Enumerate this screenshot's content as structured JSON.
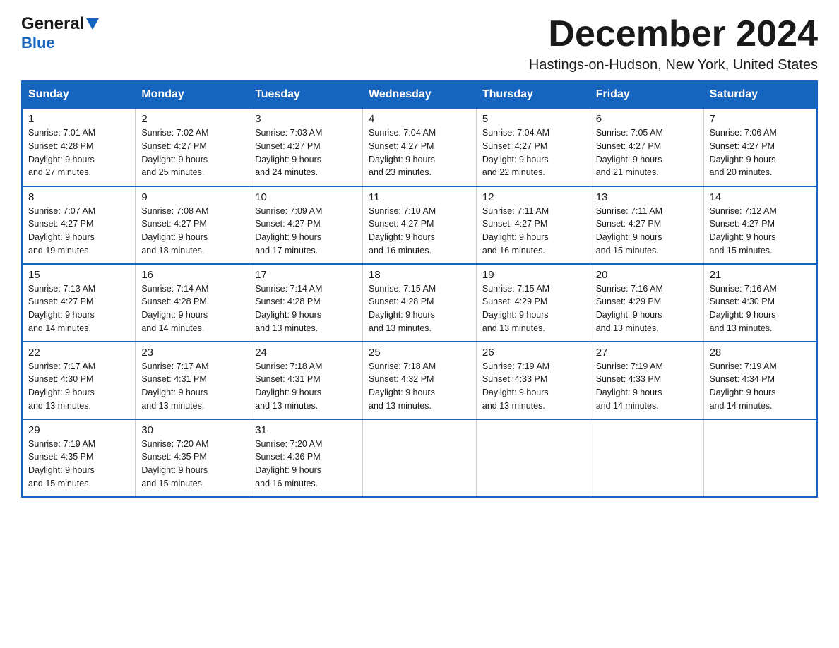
{
  "logo": {
    "general": "General",
    "triangle_alt": "triangle",
    "blue": "Blue"
  },
  "title": {
    "month_year": "December 2024",
    "location": "Hastings-on-Hudson, New York, United States"
  },
  "weekdays": [
    "Sunday",
    "Monday",
    "Tuesday",
    "Wednesday",
    "Thursday",
    "Friday",
    "Saturday"
  ],
  "weeks": [
    [
      {
        "day": "1",
        "sunrise": "7:01 AM",
        "sunset": "4:28 PM",
        "daylight": "9 hours and 27 minutes."
      },
      {
        "day": "2",
        "sunrise": "7:02 AM",
        "sunset": "4:27 PM",
        "daylight": "9 hours and 25 minutes."
      },
      {
        "day": "3",
        "sunrise": "7:03 AM",
        "sunset": "4:27 PM",
        "daylight": "9 hours and 24 minutes."
      },
      {
        "day": "4",
        "sunrise": "7:04 AM",
        "sunset": "4:27 PM",
        "daylight": "9 hours and 23 minutes."
      },
      {
        "day": "5",
        "sunrise": "7:04 AM",
        "sunset": "4:27 PM",
        "daylight": "9 hours and 22 minutes."
      },
      {
        "day": "6",
        "sunrise": "7:05 AM",
        "sunset": "4:27 PM",
        "daylight": "9 hours and 21 minutes."
      },
      {
        "day": "7",
        "sunrise": "7:06 AM",
        "sunset": "4:27 PM",
        "daylight": "9 hours and 20 minutes."
      }
    ],
    [
      {
        "day": "8",
        "sunrise": "7:07 AM",
        "sunset": "4:27 PM",
        "daylight": "9 hours and 19 minutes."
      },
      {
        "day": "9",
        "sunrise": "7:08 AM",
        "sunset": "4:27 PM",
        "daylight": "9 hours and 18 minutes."
      },
      {
        "day": "10",
        "sunrise": "7:09 AM",
        "sunset": "4:27 PM",
        "daylight": "9 hours and 17 minutes."
      },
      {
        "day": "11",
        "sunrise": "7:10 AM",
        "sunset": "4:27 PM",
        "daylight": "9 hours and 16 minutes."
      },
      {
        "day": "12",
        "sunrise": "7:11 AM",
        "sunset": "4:27 PM",
        "daylight": "9 hours and 16 minutes."
      },
      {
        "day": "13",
        "sunrise": "7:11 AM",
        "sunset": "4:27 PM",
        "daylight": "9 hours and 15 minutes."
      },
      {
        "day": "14",
        "sunrise": "7:12 AM",
        "sunset": "4:27 PM",
        "daylight": "9 hours and 15 minutes."
      }
    ],
    [
      {
        "day": "15",
        "sunrise": "7:13 AM",
        "sunset": "4:27 PM",
        "daylight": "9 hours and 14 minutes."
      },
      {
        "day": "16",
        "sunrise": "7:14 AM",
        "sunset": "4:28 PM",
        "daylight": "9 hours and 14 minutes."
      },
      {
        "day": "17",
        "sunrise": "7:14 AM",
        "sunset": "4:28 PM",
        "daylight": "9 hours and 13 minutes."
      },
      {
        "day": "18",
        "sunrise": "7:15 AM",
        "sunset": "4:28 PM",
        "daylight": "9 hours and 13 minutes."
      },
      {
        "day": "19",
        "sunrise": "7:15 AM",
        "sunset": "4:29 PM",
        "daylight": "9 hours and 13 minutes."
      },
      {
        "day": "20",
        "sunrise": "7:16 AM",
        "sunset": "4:29 PM",
        "daylight": "9 hours and 13 minutes."
      },
      {
        "day": "21",
        "sunrise": "7:16 AM",
        "sunset": "4:30 PM",
        "daylight": "9 hours and 13 minutes."
      }
    ],
    [
      {
        "day": "22",
        "sunrise": "7:17 AM",
        "sunset": "4:30 PM",
        "daylight": "9 hours and 13 minutes."
      },
      {
        "day": "23",
        "sunrise": "7:17 AM",
        "sunset": "4:31 PM",
        "daylight": "9 hours and 13 minutes."
      },
      {
        "day": "24",
        "sunrise": "7:18 AM",
        "sunset": "4:31 PM",
        "daylight": "9 hours and 13 minutes."
      },
      {
        "day": "25",
        "sunrise": "7:18 AM",
        "sunset": "4:32 PM",
        "daylight": "9 hours and 13 minutes."
      },
      {
        "day": "26",
        "sunrise": "7:19 AM",
        "sunset": "4:33 PM",
        "daylight": "9 hours and 13 minutes."
      },
      {
        "day": "27",
        "sunrise": "7:19 AM",
        "sunset": "4:33 PM",
        "daylight": "9 hours and 14 minutes."
      },
      {
        "day": "28",
        "sunrise": "7:19 AM",
        "sunset": "4:34 PM",
        "daylight": "9 hours and 14 minutes."
      }
    ],
    [
      {
        "day": "29",
        "sunrise": "7:19 AM",
        "sunset": "4:35 PM",
        "daylight": "9 hours and 15 minutes."
      },
      {
        "day": "30",
        "sunrise": "7:20 AM",
        "sunset": "4:35 PM",
        "daylight": "9 hours and 15 minutes."
      },
      {
        "day": "31",
        "sunrise": "7:20 AM",
        "sunset": "4:36 PM",
        "daylight": "9 hours and 16 minutes."
      },
      null,
      null,
      null,
      null
    ]
  ],
  "labels": {
    "sunrise": "Sunrise:",
    "sunset": "Sunset:",
    "daylight": "Daylight:"
  }
}
